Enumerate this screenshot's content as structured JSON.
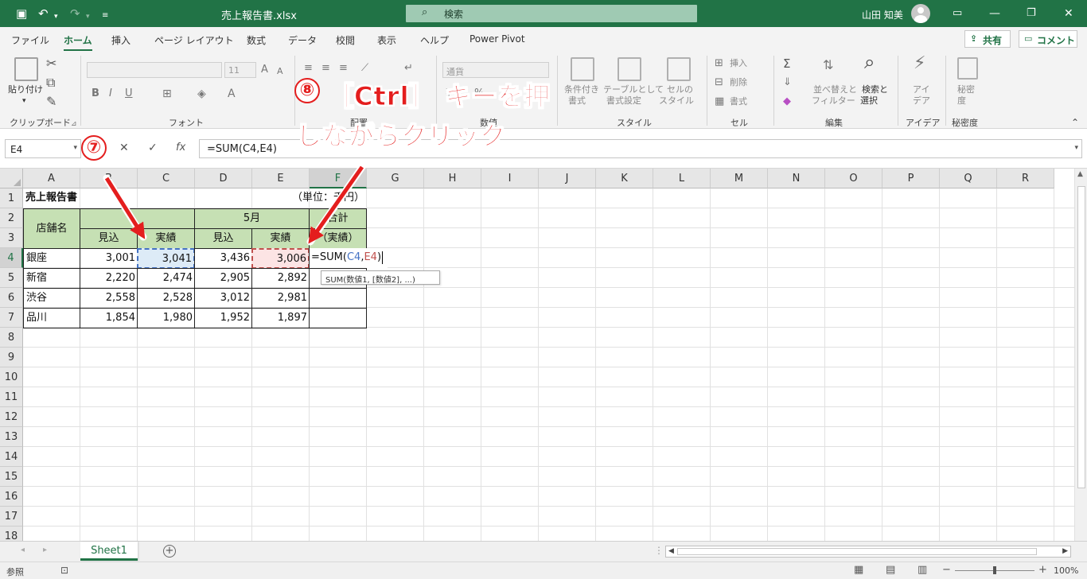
{
  "titlebar": {
    "doc_title": "売上報告書.xlsx",
    "search_label": "検索",
    "user_name": "山田 知美",
    "save_icon": "save-icon",
    "undo_icon": "undo-icon",
    "redo_icon": "redo-icon",
    "customize_icon": "customize-icon"
  },
  "tabs": [
    "ファイル",
    "ホーム",
    "挿入",
    "ページ レイアウト",
    "数式",
    "データ",
    "校閲",
    "表示",
    "ヘルプ",
    "Power Pivot"
  ],
  "active_tab": "ホーム",
  "share_label": "共有",
  "comment_label": "コメント",
  "ribbon": {
    "paste_label": "貼り付け",
    "clipboard_label": "クリップボード",
    "font_label": "フォント",
    "font_size": "11",
    "align_label": "配置",
    "number_label": "数値",
    "number_format": "通貨",
    "style_label": "スタイル",
    "cond_format_l1": "条件付き",
    "cond_format_l2": "書式",
    "table_format_l1": "テーブルとして",
    "table_format_l2": "書式設定",
    "cell_style_l1": "セルの",
    "cell_style_l2": "スタイル",
    "cells_label": "セル",
    "insert_label": "挿入",
    "delete_label": "削除",
    "format_label": "書式",
    "edit_label": "編集",
    "sort_l1": "並べ替えと",
    "sort_l2": "フィルター",
    "find_l1": "検索と",
    "find_l2": "選択",
    "ideas_label": "アイデア",
    "ideas_l1": "アイ",
    "ideas_l2": "デア",
    "sens_label": "秘密度",
    "sens_l1": "秘密",
    "sens_l2": "度"
  },
  "formula": {
    "name_box": "E4",
    "text": "=SUM(C4,E4)"
  },
  "columns": [
    "A",
    "B",
    "C",
    "D",
    "E",
    "F",
    "G",
    "H",
    "I",
    "J",
    "K",
    "L",
    "M",
    "N",
    "O",
    "P",
    "Q",
    "R"
  ],
  "selected_column": "F",
  "rows": [
    "1",
    "2",
    "3",
    "4",
    "5",
    "6",
    "7",
    "8",
    "9",
    "10",
    "11",
    "12",
    "13",
    "14",
    "15",
    "16",
    "17",
    "18"
  ],
  "selected_row": "4",
  "sheet": {
    "title": "売上報告書",
    "unit": "（単位：千円）",
    "h_store": "店舗名",
    "h_month5": "5月",
    "h_total_l1": "合計",
    "h_total_l2": "（実績）",
    "h_plan": "見込",
    "h_actual": "実績",
    "data": [
      [
        "銀座",
        "3,001",
        "3,041",
        "3,436",
        "3,006"
      ],
      [
        "新宿",
        "2,220",
        "2,474",
        "2,905",
        "2,892"
      ],
      [
        "渋谷",
        "2,558",
        "2,528",
        "3,012",
        "2,981"
      ],
      [
        "品川",
        "1,854",
        "1,980",
        "1,952",
        "1,897"
      ]
    ],
    "editing_formula_prefix": "=SUM(",
    "editing_ref1": "C4",
    "editing_comma": ",",
    "editing_ref2": "E4",
    "editing_suffix": ")",
    "tooltip": "SUM(数値1, [数値2], ...)"
  },
  "sheet_tab": "Sheet1",
  "status": {
    "mode": "参照",
    "zoom": "100%"
  },
  "annotations": {
    "step7": "⑦",
    "step8": "⑧",
    "note_line1": "［Ctrl］ キーを押",
    "note_line2": "しながらクリック"
  },
  "colors": {
    "excel_green": "#217346",
    "header_fill": "#c6e0b4",
    "ref1": "#4472c4",
    "ref2": "#c0504d",
    "annotation_red": "#e41e1e"
  }
}
